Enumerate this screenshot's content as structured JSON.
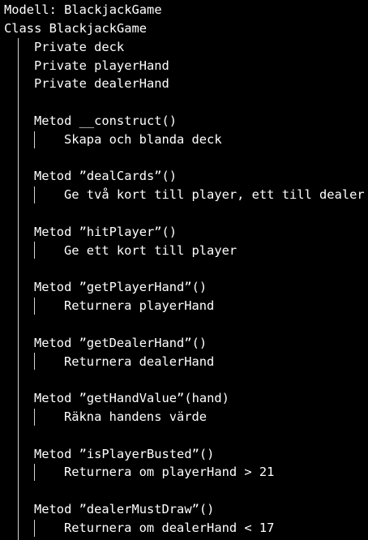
{
  "pseudocode": {
    "title": "Modell: BlackjackGame",
    "class_header": "Class BlackjackGame",
    "fields": [
      "Private deck",
      "Private playerHand",
      "Private dealerHand"
    ],
    "methods": [
      {
        "signature": "Metod __construct()",
        "body": "Skapa och blanda deck"
      },
      {
        "signature": "Metod ”dealCards”()",
        "body": "Ge två kort till player, ett till dealer"
      },
      {
        "signature": "Metod ”hitPlayer”()",
        "body": "Ge ett kort till player"
      },
      {
        "signature": "Metod ”getPlayerHand”()",
        "body": "Returnera playerHand"
      },
      {
        "signature": "Metod ”getDealerHand”()",
        "body": "Returnera dealerHand"
      },
      {
        "signature": "Metod ”getHandValue”(hand)",
        "body": "Räkna handens värde"
      },
      {
        "signature": "Metod ”isPlayerBusted”()",
        "body": "Returnera om playerHand > 21"
      },
      {
        "signature": "Metod ”dealerMustDraw”()",
        "body": "Returnera om dealerHand < 17"
      }
    ]
  }
}
